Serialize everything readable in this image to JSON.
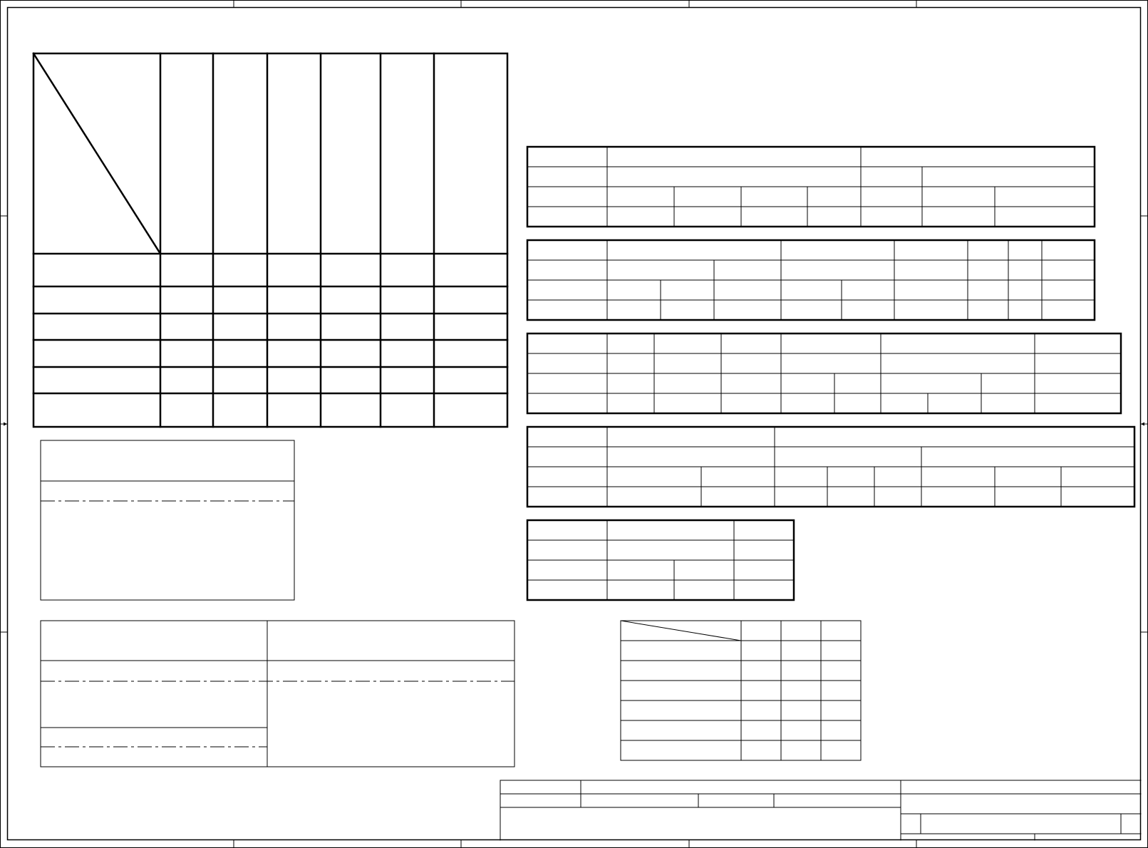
{
  "sheet": {
    "title": "",
    "stroke_color": "#000000",
    "background_color": "#ffffff"
  },
  "tables": []
}
